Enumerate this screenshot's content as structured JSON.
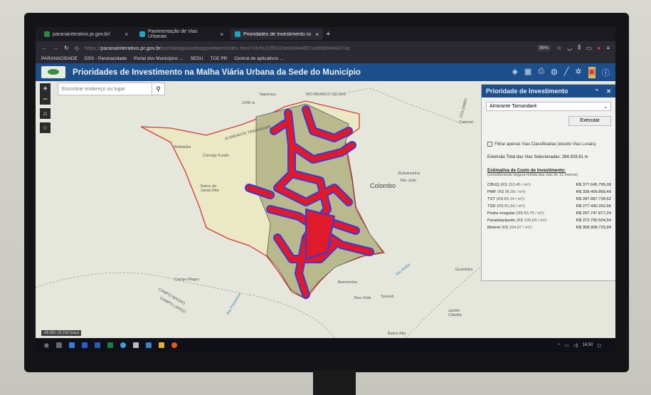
{
  "browser": {
    "tabs": [
      {
        "label": "paranainterativo.pr.gov.br/",
        "active": false
      },
      {
        "label": "Pavimentação de Vias Urbanas",
        "active": false
      },
      {
        "label": "Prioridades de Investimento na",
        "active": true
      }
    ],
    "url_domain": "paranainterativo.pr.gov.br",
    "url_path": "/portal/apps/webappviewer/index.html?id=fa31ff6315ed49a4857ad8989e4437ac",
    "url_prefix": "https://",
    "zoom": "90%",
    "bookmarks": [
      "PARANACIDADE",
      "DSS - Paranacidade",
      "Portal dos Municípios ...",
      "SEDU",
      "TCE PR",
      "Central de aplicativos ..."
    ]
  },
  "app": {
    "title": "Prioridades de Investimento na Malha Viária Urbana da Sede do Município",
    "search_placeholder": "Encontrar endereço ou lugar",
    "coords": "-49.300 -25.218 Graus",
    "map_labels": {
      "itaperucu": "Itaperuçu",
      "rio_branco": "RIO BRANCO DO SUL",
      "elev": "1246 m",
      "almirante": "ALMIRANTE TAMANDARÉ",
      "botiatuba": "Botiatuba",
      "corrego": "Córrego Fundo",
      "santa_rita": "Bairro de Santa Rita",
      "colombo": "Colombo",
      "colombo_road": "COLOMBO",
      "capivari": "Capivari",
      "butiatuvinha": "Butiatuvinha",
      "sao_joao": "São João",
      "campo_magro": "Campo Magro",
      "campo_magro_lim": "CAMPO MAGRO",
      "campo_largo": "CAMPO LARGO",
      "barreirinha": "Barreirinha",
      "boa_vista": "Boa Vista",
      "taruma": "Tarumã",
      "jardim_claudia": "Jardim Cláudia",
      "bairro_alto": "Bairro Alto",
      "guarituba": "Guarituba",
      "rio_passauna": "Rio Passaúna",
      "rio_atuba": "Rio Atuba"
    }
  },
  "panel": {
    "title": "Prioridade de Investimento",
    "municipio": "Almirante Tamandaré",
    "execute": "Executar",
    "filter_label": "Filtrar apenas Vias Classificadas (exceto Vias Locais)",
    "filter_checked": false,
    "total": "Extensão Total das Vias Selecionadas: 284.929,61 m",
    "estimate_title": "Estimativa de Custo de Investimento:",
    "estimate_sub": "(considerando largura média das vias de 12 metros)",
    "costs": [
      {
        "name": "CBUQ",
        "rate": "(R$ 110,45 / m²):",
        "value": "R$ 377.645.795,09"
      },
      {
        "name": "PMF",
        "rate": "(R$ 96,05 / m²):",
        "value": "R$ 328.409.868,49"
      },
      {
        "name": "TST",
        "rate": "(R$ 84,14 / m²):",
        "value": "R$ 287.687.728,62"
      },
      {
        "name": "TSD",
        "rate": "(R$ 81,56 / m²):",
        "value": "R$ 277.430.262,66"
      },
      {
        "name": "Pedra Irregular",
        "rate": "(R$ 60,76 / m²):",
        "value": "R$ 207.747.877,24"
      },
      {
        "name": "Paralelepípedo",
        "rate": "(R$ 109,03 / m²):",
        "value": "R$ 372.790.504,54"
      },
      {
        "name": "Blokret",
        "rate": "(R$ 104,97 / m²):",
        "value": "R$ 358.908.733,94"
      }
    ]
  },
  "taskbar": {
    "time": "14:50"
  },
  "colors": {
    "header": "#1d4f8d",
    "boundary": "#d23a3a",
    "priority": "#e01a2a",
    "priority_edge": "#3a3ad8",
    "area": "#c9c9a3"
  }
}
